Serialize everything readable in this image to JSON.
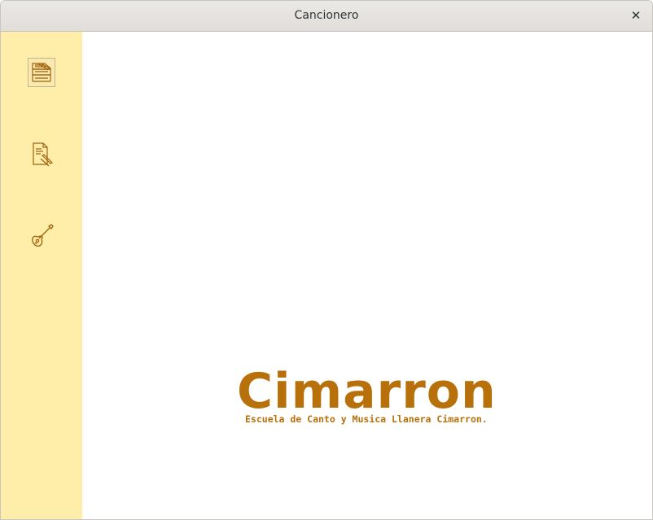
{
  "window": {
    "title": "Cancionero"
  },
  "sidebar": {
    "items": [
      {
        "icon": "songbook-stack-icon",
        "active": true
      },
      {
        "icon": "document-edit-icon",
        "active": false
      },
      {
        "icon": "guitar-icon",
        "active": false
      }
    ]
  },
  "main": {
    "brand": "Cimarron",
    "tagline": "Escuela de Canto y Musica Llanera Cimarron."
  },
  "colors": {
    "accent": "#b8700b",
    "sidebar_bg": "#ffeeaa",
    "icon": "#a0600a"
  }
}
